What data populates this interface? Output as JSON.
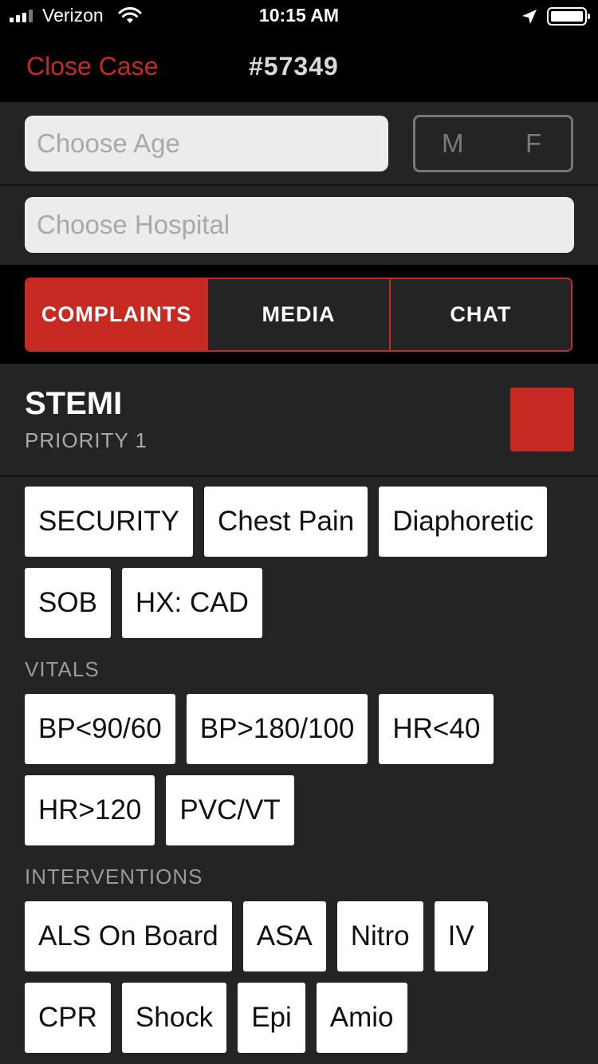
{
  "status_bar": {
    "carrier": "Verizon",
    "time": "10:15 AM",
    "battery_level": 1.0
  },
  "nav": {
    "close_label": "Close Case",
    "case_number": "#57349"
  },
  "patient": {
    "age_placeholder": "Choose Age",
    "sex_male": "M",
    "sex_female": "F",
    "hospital_placeholder": "Choose Hospital"
  },
  "tabs": [
    {
      "label": "COMPLAINTS",
      "active": true
    },
    {
      "label": "MEDIA",
      "active": false
    },
    {
      "label": "CHAT",
      "active": false
    }
  ],
  "condition": {
    "title": "STEMI",
    "priority": "PRIORITY 1",
    "color": "#c62a22"
  },
  "complaints": [
    "SECURITY",
    "Chest Pain",
    "Diaphoretic",
    "SOB",
    "HX: CAD"
  ],
  "vitals_label": "VITALS",
  "vitals": [
    "BP<90/60",
    "BP>180/100",
    "HR<40",
    "HR>120",
    "PVC/VT"
  ],
  "interventions_label": "INTERVENTIONS",
  "interventions": [
    "ALS On Board",
    "ASA",
    "Nitro",
    "IV",
    "CPR",
    "Shock",
    "Epi",
    "Amio"
  ],
  "colors": {
    "accent": "#c62a22",
    "background": "#242424"
  }
}
